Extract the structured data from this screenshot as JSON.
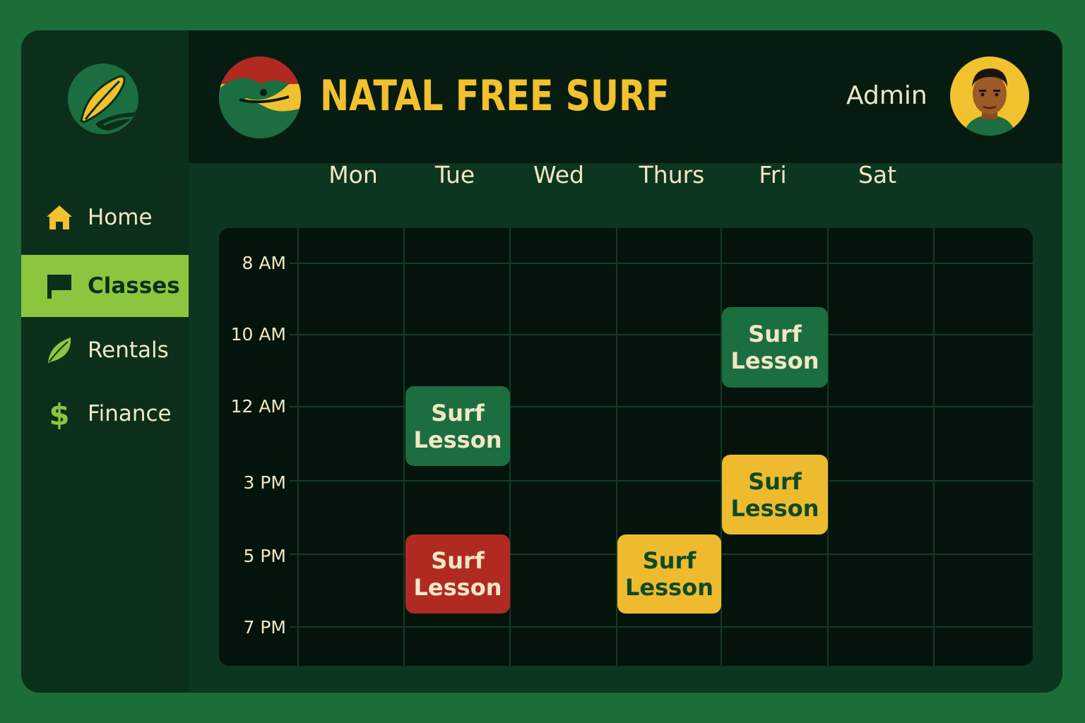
{
  "brand": {
    "name": "NATAL FREE SURF",
    "logo_icon": "surf-wave-logo-icon",
    "sidebar_logo_icon": "surfboard-leaf-logo-icon"
  },
  "header": {
    "user_label": "Admin",
    "avatar_icon": "user-avatar"
  },
  "sidebar": {
    "items": [
      {
        "label": "Home",
        "icon": "home-icon",
        "active": false
      },
      {
        "label": "Classes",
        "icon": "flag-icon",
        "active": true
      },
      {
        "label": "Rentals",
        "icon": "leaf-icon",
        "active": false
      },
      {
        "label": "Finance",
        "icon": "dollar-icon",
        "active": false
      }
    ]
  },
  "calendar": {
    "days": [
      "Mon",
      "Tue",
      "Wed",
      "Thurs",
      "Fri",
      "Sat"
    ],
    "times": [
      "8 AM",
      "10 AM",
      "12 AM",
      "3 PM",
      "5 PM",
      "7 PM"
    ],
    "events": [
      {
        "day": "Fri",
        "time": "10 AM",
        "line1": "Surf",
        "line2": "Lesson",
        "color": "green"
      },
      {
        "day": "Tue",
        "time": "12 AM",
        "line1": "Surf",
        "line2": "Lesson",
        "color": "green"
      },
      {
        "day": "Fri",
        "time": "3 PM",
        "line1": "Surf",
        "line2": "Lesson",
        "color": "yellow"
      },
      {
        "day": "Tue",
        "time": "5 PM",
        "line1": "Surf",
        "line2": "Lesson",
        "color": "red"
      },
      {
        "day": "Thurs",
        "time": "5 PM",
        "line1": "Surf",
        "line2": "Lesson",
        "color": "yellow"
      }
    ]
  },
  "colors": {
    "page_bg": "#1b6e38",
    "accent_yellow": "#f2c12e",
    "accent_lime": "#8cc63f",
    "event_green": "#1b6e3f",
    "event_red": "#b12a22",
    "event_yellow": "#eebb2f"
  }
}
